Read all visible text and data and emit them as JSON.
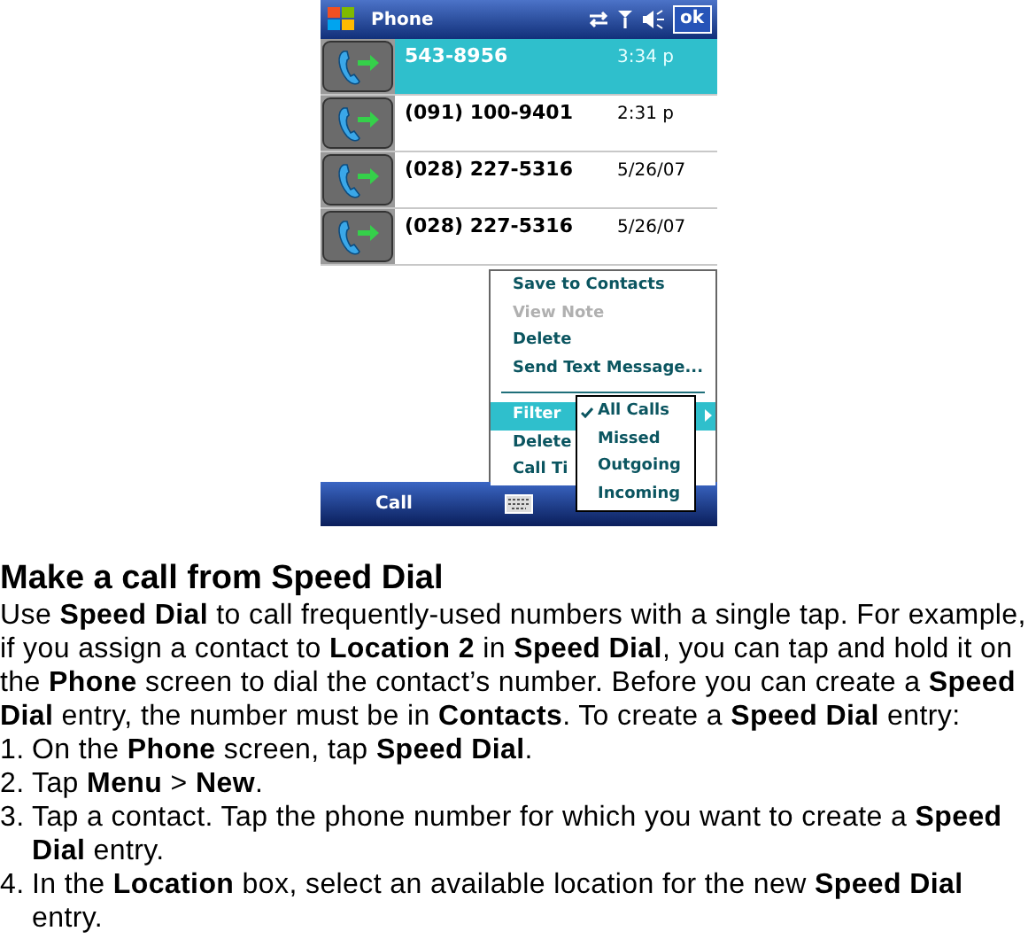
{
  "phone": {
    "title": "Phone",
    "ok_button": "ok",
    "calls": [
      {
        "number": "543-8956",
        "time": "3:34 p",
        "selected": true
      },
      {
        "number": "(091) 100-9401",
        "time": "2:31 p",
        "selected": false
      },
      {
        "number": "(028) 227-5316",
        "time": "5/26/07",
        "selected": false
      },
      {
        "number": "(028) 227-5316",
        "time": "5/26/07",
        "selected": false
      }
    ],
    "menu": [
      {
        "kind": "item",
        "label": "Save to Contacts",
        "disabled": false,
        "selected": false,
        "submenu": false
      },
      {
        "kind": "item",
        "label": "View Note",
        "disabled": true,
        "selected": false,
        "submenu": false
      },
      {
        "kind": "item",
        "label": "Delete",
        "disabled": false,
        "selected": false,
        "submenu": false
      },
      {
        "kind": "item",
        "label": "Send Text Message...",
        "disabled": false,
        "selected": false,
        "submenu": false
      },
      {
        "kind": "divider"
      },
      {
        "kind": "item",
        "label": "Filter",
        "disabled": false,
        "selected": true,
        "submenu": true
      },
      {
        "kind": "item",
        "label": "Delete",
        "disabled": false,
        "selected": false,
        "submenu": false
      },
      {
        "kind": "item",
        "label": "Call Ti",
        "disabled": false,
        "selected": false,
        "submenu": false
      }
    ],
    "submenu": [
      {
        "label": "All Calls",
        "checked": true
      },
      {
        "label": "Missed",
        "checked": false
      },
      {
        "label": "Outgoing",
        "checked": false
      },
      {
        "label": "Incoming",
        "checked": false
      }
    ],
    "left_softkey": "Call"
  },
  "heading": "Make a call from Speed Dial",
  "intro": "Use **Speed Dial** to call frequently-used numbers with a single tap. For example, if you assign a contact to **Location 2** in **Speed Dial**, you can tap and hold it on the **Phone** screen to dial the contact’s number. Before you can create a **Speed Dial** entry, the number must be in **Contacts**. To create a **Speed Dial** entry:",
  "steps": [
    {
      "number": "1.",
      "text": "On the **Phone** screen, tap **Speed Dial**."
    },
    {
      "number": "2.",
      "text": "Tap **Menu** > **New**."
    },
    {
      "number": "3.",
      "text": "Tap a contact. Tap the phone number for which you want to create a **Speed Dial** entry."
    },
    {
      "number": "4.",
      "text": "In the **Location** box, select an available location for the new **Speed Dial** entry."
    }
  ]
}
